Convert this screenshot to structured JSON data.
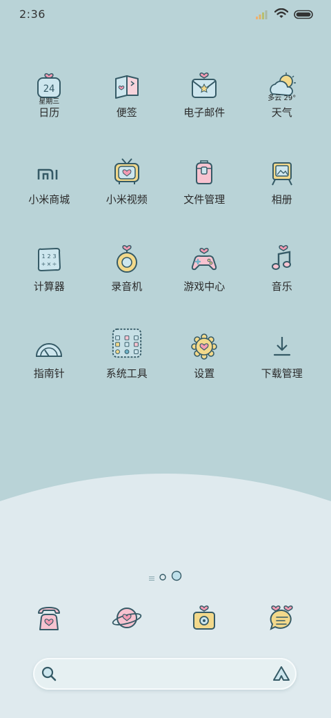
{
  "status_bar": {
    "time": "2:36",
    "signal_icon": "signal-icon",
    "wifi_icon": "wifi-icon",
    "battery_icon": "battery-icon"
  },
  "apps": [
    {
      "label": "日历",
      "icon": "calendar-icon",
      "date_number": "24",
      "sub_label": "星期三"
    },
    {
      "label": "便签",
      "icon": "notes-icon"
    },
    {
      "label": "电子邮件",
      "icon": "email-icon"
    },
    {
      "label": "天气",
      "icon": "weather-icon",
      "sub_label": "多云 29°"
    },
    {
      "label": "小米商城",
      "icon": "mi-store-icon"
    },
    {
      "label": "小米视频",
      "icon": "tv-icon"
    },
    {
      "label": "文件管理",
      "icon": "file-manager-icon"
    },
    {
      "label": "相册",
      "icon": "gallery-icon"
    },
    {
      "label": "计算器",
      "icon": "calculator-icon",
      "keys": [
        "1",
        "2",
        "3",
        "+",
        "×",
        "÷"
      ]
    },
    {
      "label": "录音机",
      "icon": "recorder-icon"
    },
    {
      "label": "游戏中心",
      "icon": "gamepad-icon"
    },
    {
      "label": "音乐",
      "icon": "music-icon"
    },
    {
      "label": "指南针",
      "icon": "compass-icon"
    },
    {
      "label": "系统工具",
      "icon": "system-tools-folder-icon"
    },
    {
      "label": "设置",
      "icon": "settings-icon"
    },
    {
      "label": "下载管理",
      "icon": "download-icon"
    }
  ],
  "page_indicator": {
    "pages": 2,
    "current_page": 2
  },
  "dock": [
    {
      "icon": "phone-icon"
    },
    {
      "icon": "browser-planet-icon"
    },
    {
      "icon": "camera-icon"
    },
    {
      "icon": "messages-icon"
    }
  ],
  "search_bar": {
    "left_icon": "search-icon",
    "right_icon": "assistant-icon"
  },
  "colors": {
    "background": "#b9d3d7",
    "bottom_panel": "#dfeaee",
    "outline": "#355a66",
    "pink": "#f4a7bd",
    "yellow": "#f3d98b",
    "light_blue": "#cde6ee"
  }
}
